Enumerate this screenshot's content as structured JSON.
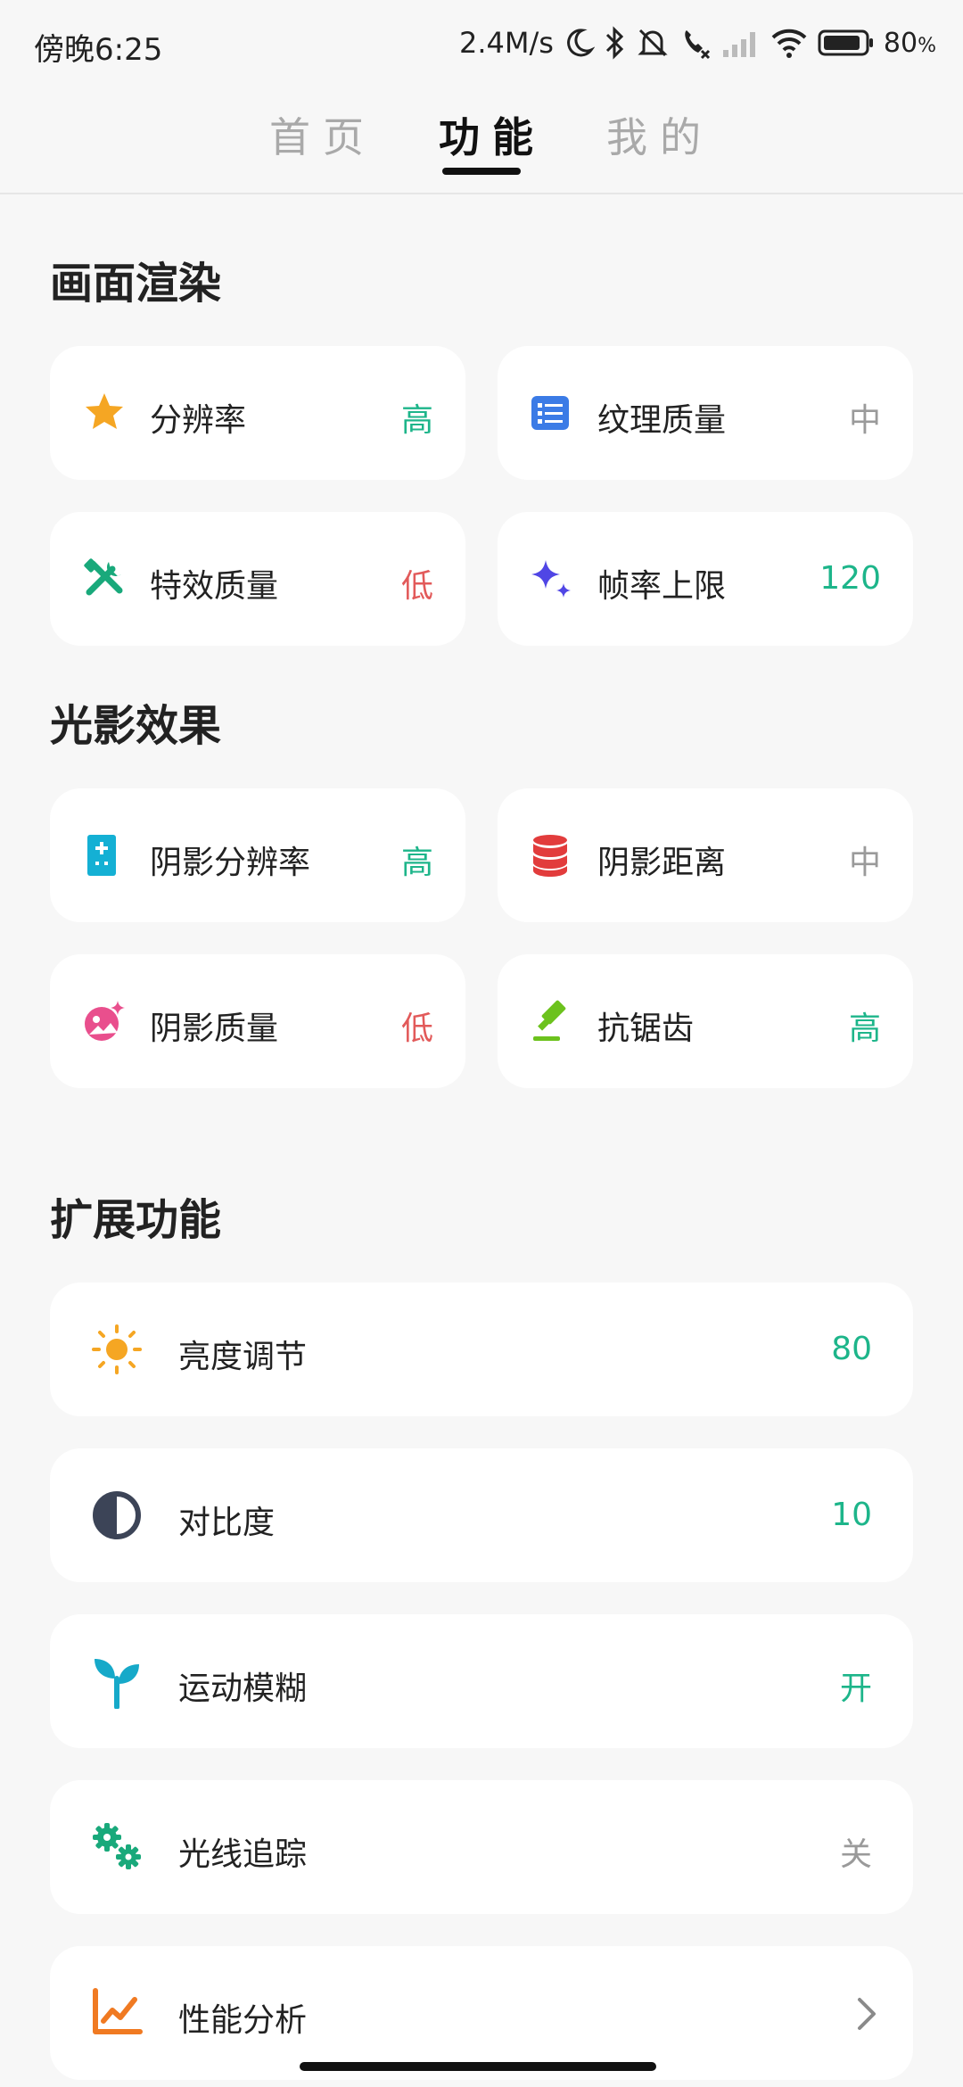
{
  "status_bar": {
    "time": "傍晚6:25",
    "net_speed": "2.4M/s",
    "battery_pct": "80",
    "battery_unit": "%"
  },
  "tabs": [
    {
      "label": "首页",
      "active": false
    },
    {
      "label": "功能",
      "active": true
    },
    {
      "label": "我的",
      "active": false
    }
  ],
  "sections": {
    "render": {
      "title": "画面渲染",
      "items": [
        {
          "label": "分辨率",
          "value": "高",
          "icon": "star-burst-icon"
        },
        {
          "label": "纹理质量",
          "value": "中",
          "icon": "list-icon"
        },
        {
          "label": "特效质量",
          "value": "低",
          "icon": "tools-icon"
        },
        {
          "label": "帧率上限",
          "value": "120",
          "icon": "sparkle-icon"
        }
      ]
    },
    "lighting": {
      "title": "光影效果",
      "items": [
        {
          "label": "阴影分辨率",
          "value": "高",
          "icon": "device-plus-icon"
        },
        {
          "label": "阴影距离",
          "value": "中",
          "icon": "database-icon"
        },
        {
          "label": "阴影质量",
          "value": "低",
          "icon": "image-sparkle-icon"
        },
        {
          "label": "抗锯齿",
          "value": "高",
          "icon": "gavel-icon"
        }
      ]
    },
    "extended": {
      "title": "扩展功能",
      "items": [
        {
          "label": "亮度调节",
          "value": "80",
          "icon": "sun-icon"
        },
        {
          "label": "对比度",
          "value": "10",
          "icon": "contrast-icon"
        },
        {
          "label": "运动模糊",
          "value": "开",
          "icon": "sprout-icon"
        },
        {
          "label": "光线追踪",
          "value": "关",
          "icon": "gears-icon"
        },
        {
          "label": "性能分析",
          "value": "",
          "icon": "chart-line-icon"
        }
      ]
    }
  },
  "colors": {
    "high": "#1db58a",
    "mid": "#9a9a9a",
    "low": "#e25a5a"
  }
}
